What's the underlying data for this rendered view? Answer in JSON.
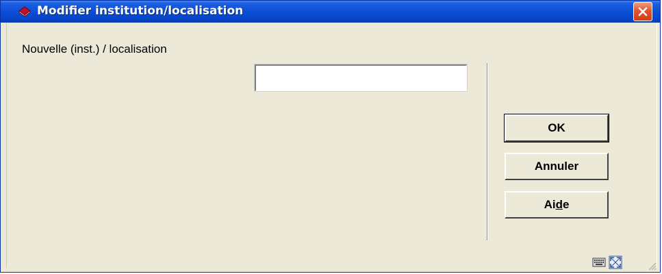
{
  "window": {
    "title": "Modifier institution/localisation",
    "icon": "book-icon",
    "close_icon": "close-icon"
  },
  "form": {
    "field_label": "Nouvelle (inst.) / localisation",
    "field_value": "",
    "field_placeholder": ""
  },
  "buttons": {
    "ok_label": "OK",
    "cancel_label": "Annuler",
    "help_label_pre": "Ai",
    "help_label_mnemonic": "d",
    "help_label_post": "e"
  },
  "status_bar": {
    "icons": [
      "keyboard-icon",
      "fullscreen-icon",
      "resize-grip-icon"
    ]
  },
  "colors": {
    "titlebar": "#0a4fd8",
    "dialog_bg": "#ece9d8",
    "close_button": "#e4532c"
  }
}
